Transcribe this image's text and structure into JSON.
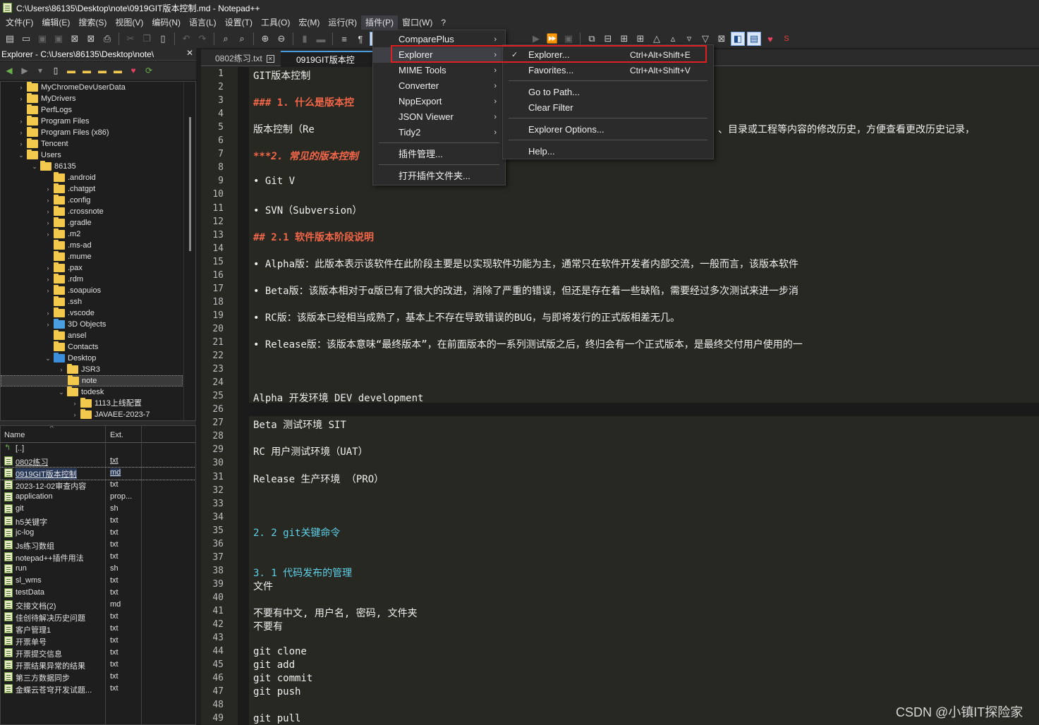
{
  "window": {
    "title": "C:\\Users\\86135\\Desktop\\note\\0919GIT版本控制.md - Notepad++"
  },
  "menubar": {
    "items": [
      "文件(F)",
      "编辑(E)",
      "搜索(S)",
      "视图(V)",
      "编码(N)",
      "语言(L)",
      "设置(T)",
      "工具(O)",
      "宏(M)",
      "运行(R)",
      "插件(P)",
      "窗口(W)",
      "?"
    ]
  },
  "explorer": {
    "title": "Explorer - C:\\Users\\86135\\Desktop\\note\\",
    "close": "✕",
    "tree": [
      {
        "label": "MyChromeDevUserData",
        "depth": 2,
        "chev": "›"
      },
      {
        "label": "MyDrivers",
        "depth": 2,
        "chev": "›"
      },
      {
        "label": "PerfLogs",
        "depth": 2,
        "chev": ""
      },
      {
        "label": "Program Files",
        "depth": 2,
        "chev": "›"
      },
      {
        "label": "Program Files (x86)",
        "depth": 2,
        "chev": "›"
      },
      {
        "label": "Tencent",
        "depth": 2,
        "chev": "›"
      },
      {
        "label": "Users",
        "depth": 2,
        "chev": "⌄"
      },
      {
        "label": "86135",
        "depth": 3,
        "chev": "⌄"
      },
      {
        "label": ".android",
        "depth": 4,
        "chev": ""
      },
      {
        "label": ".chatgpt",
        "depth": 4,
        "chev": "›"
      },
      {
        "label": ".config",
        "depth": 4,
        "chev": "›"
      },
      {
        "label": ".crossnote",
        "depth": 4,
        "chev": "›"
      },
      {
        "label": ".gradle",
        "depth": 4,
        "chev": "›"
      },
      {
        "label": ".m2",
        "depth": 4,
        "chev": "›"
      },
      {
        "label": ".ms-ad",
        "depth": 4,
        "chev": ""
      },
      {
        "label": ".mume",
        "depth": 4,
        "chev": ""
      },
      {
        "label": ".pax",
        "depth": 4,
        "chev": "›"
      },
      {
        "label": ".rdm",
        "depth": 4,
        "chev": "›"
      },
      {
        "label": ".soapuios",
        "depth": 4,
        "chev": "›"
      },
      {
        "label": ".ssh",
        "depth": 4,
        "chev": ""
      },
      {
        "label": ".vscode",
        "depth": 4,
        "chev": "›"
      },
      {
        "label": "3D Objects",
        "depth": 4,
        "chev": "›",
        "icon": "blue"
      },
      {
        "label": "ansel",
        "depth": 4,
        "chev": ""
      },
      {
        "label": "Contacts",
        "depth": 4,
        "chev": ""
      },
      {
        "label": "Desktop",
        "depth": 4,
        "chev": "⌄",
        "icon": "desk"
      },
      {
        "label": "JSR3",
        "depth": 5,
        "chev": "›"
      },
      {
        "label": "note",
        "depth": 5,
        "chev": "",
        "selected": true
      },
      {
        "label": "todesk",
        "depth": 5,
        "chev": "⌄"
      },
      {
        "label": "1113上线配置",
        "depth": 6,
        "chev": "›"
      },
      {
        "label": "JAVAEE-2023-7",
        "depth": 6,
        "chev": "›"
      }
    ],
    "columns": {
      "name": "Name",
      "ext": "Ext."
    },
    "files": [
      {
        "name": "[..]",
        "ext": "",
        "up": true
      },
      {
        "name": "0802练习",
        "ext": "txt",
        "u": true
      },
      {
        "name": "0919GIT版本控制",
        "ext": "md",
        "u": true,
        "selected": true
      },
      {
        "name": "2023-12-02审查内容",
        "ext": "txt"
      },
      {
        "name": "application",
        "ext": "prop..."
      },
      {
        "name": "git",
        "ext": "sh"
      },
      {
        "name": "h5关键字",
        "ext": "txt"
      },
      {
        "name": "jc-log",
        "ext": "txt"
      },
      {
        "name": "Js练习数组",
        "ext": "txt"
      },
      {
        "name": "notepad++插件用法",
        "ext": "txt"
      },
      {
        "name": "run",
        "ext": "sh"
      },
      {
        "name": "sl_wms",
        "ext": "txt"
      },
      {
        "name": "testData",
        "ext": "txt"
      },
      {
        "name": "交接文档(2)",
        "ext": "md"
      },
      {
        "name": "佳创待解决历史问题",
        "ext": "txt"
      },
      {
        "name": "客户管理1",
        "ext": "txt"
      },
      {
        "name": "开票单号",
        "ext": "txt"
      },
      {
        "name": "开票提交信息",
        "ext": "txt"
      },
      {
        "name": "开票结果异常的结果",
        "ext": "txt"
      },
      {
        "name": "第三方数据同步",
        "ext": "txt"
      },
      {
        "name": "金蝶云苍穹开发试题...",
        "ext": "txt"
      }
    ]
  },
  "tabs": [
    {
      "label": "0802练习.txt",
      "close": "✕"
    },
    {
      "label": "0919GIT版本控制.m",
      "active": true
    }
  ],
  "editor": {
    "lines": [
      {
        "n": "1",
        "text": "GIT版本控制",
        "cls": ""
      },
      {
        "n": "2",
        "text": "",
        "cls": ""
      },
      {
        "n": "3",
        "text": "### 1. 什么是版本控",
        "cls": "h"
      },
      {
        "n": "4",
        "text": "",
        "cls": ""
      },
      {
        "n": "5",
        "text": "       版本控制（Re",
        "cls": ""
      },
      {
        "n": "6",
        "text": "",
        "cls": ""
      },
      {
        "n": "7",
        "text": "***2. 常见的版本控制",
        "cls": "ital"
      },
      {
        "n": "8",
        "text": "",
        "cls": ""
      },
      {
        "n": "9",
        "text": "• Git   V",
        "cls": ""
      },
      {
        "n": "10",
        "text": "",
        "cls": ""
      },
      {
        "n": "11",
        "text": "• SVN（Subversion）",
        "cls": ""
      },
      {
        "n": "12",
        "text": "",
        "cls": ""
      },
      {
        "n": "13",
        "text": "##   2.1     软件版本阶段说明",
        "cls": "h"
      },
      {
        "n": "14",
        "text": "",
        "cls": ""
      },
      {
        "n": "15",
        "text": "                • Alpha版：此版本表示该软件在此阶段主要是以实现软件功能为主，通常只在软件开发者内部交流，一般而言，该版本软件",
        "cls": ""
      },
      {
        "n": "16",
        "text": "",
        "cls": ""
      },
      {
        "n": "17",
        "text": "                • Beta版：该版本相对于α版已有了很大的改进，消除了严重的错误，但还是存在着一些缺陷，需要经过多次测试来进一步消",
        "cls": ""
      },
      {
        "n": "18",
        "text": "",
        "cls": ""
      },
      {
        "n": "19",
        "text": "                • RC版：该版本已经相当成熟了，基本上不存在导致错误的BUG，与即将发行的正式版相差无几。",
        "cls": ""
      },
      {
        "n": "20",
        "text": "",
        "cls": ""
      },
      {
        "n": "21",
        "text": "                • Release版：该版本意味“最终版本”，在前面版本的一系列测试版之后，终归会有一个正式版本，是最终交付用户使用的一",
        "cls": ""
      },
      {
        "n": "22",
        "text": "",
        "cls": ""
      },
      {
        "n": "23",
        "text": "",
        "cls": ""
      },
      {
        "n": "24",
        "text": "",
        "cls": ""
      },
      {
        "n": "25",
        "text": "Alpha 开发环境 DEV  development",
        "cls": ""
      },
      {
        "n": "26",
        "text": "",
        "cls": ""
      },
      {
        "n": "27",
        "text": "Beta 测试环境 SIT",
        "cls": ""
      },
      {
        "n": "28",
        "text": "",
        "cls": ""
      },
      {
        "n": "29",
        "text": "RC 用户测试环境（UAT）",
        "cls": ""
      },
      {
        "n": "30",
        "text": "",
        "cls": ""
      },
      {
        "n": "31",
        "text": "Release 生产环境 （PRO）",
        "cls": ""
      },
      {
        "n": "32",
        "text": "",
        "cls": ""
      },
      {
        "n": "33",
        "text": "",
        "cls": ""
      },
      {
        "n": "34",
        "text": "",
        "cls": ""
      },
      {
        "n": "35",
        "text": "2. 2 git关键命令",
        "cls": "num"
      },
      {
        "n": "36",
        "text": "",
        "cls": ""
      },
      {
        "n": "37",
        "text": "",
        "cls": ""
      },
      {
        "n": "38",
        "text": "3. 1 代码发布的管理",
        "cls": "num"
      },
      {
        "n": "39",
        "text": "文件",
        "cls": ""
      },
      {
        "n": "40",
        "text": "",
        "cls": ""
      },
      {
        "n": "41",
        "text": "不要有中文, 用户名, 密码, 文件夹",
        "cls": ""
      },
      {
        "n": "42",
        "text": "不要有",
        "cls": ""
      },
      {
        "n": "43",
        "text": "",
        "cls": ""
      },
      {
        "n": "44",
        "text": "git clone",
        "cls": ""
      },
      {
        "n": "45",
        "text": "git add",
        "cls": ""
      },
      {
        "n": "46",
        "text": "git commit",
        "cls": ""
      },
      {
        "n": "47",
        "text": "git push",
        "cls": ""
      },
      {
        "n": "48",
        "text": "",
        "cls": ""
      },
      {
        "n": "49",
        "text": "git pull",
        "cls": ""
      }
    ],
    "line5_tail": "、目录或工程等内容的修改历史，方便查看更改历史记录，"
  },
  "plugins_menu": {
    "items": [
      {
        "label": "ComparePlus",
        "arrow": "›"
      },
      {
        "label": "Explorer",
        "arrow": "›",
        "highlighted": true
      },
      {
        "label": "MIME Tools",
        "arrow": "›"
      },
      {
        "label": "Converter",
        "arrow": "›"
      },
      {
        "label": "NppExport",
        "arrow": "›"
      },
      {
        "label": "JSON Viewer",
        "arrow": "›"
      },
      {
        "label": "Tidy2",
        "arrow": "›"
      },
      {
        "label": "插件管理...",
        "arrow": ""
      },
      {
        "label": "打开插件文件夹...",
        "arrow": ""
      }
    ]
  },
  "explorer_submenu": {
    "items": [
      {
        "label": "Explorer...",
        "shortcut": "Ctrl+Alt+Shift+E",
        "checked": true
      },
      {
        "label": "Favorites...",
        "shortcut": "Ctrl+Alt+Shift+V"
      },
      {
        "label": "Go to Path...",
        "shortcut": ""
      },
      {
        "label": "Clear Filter",
        "shortcut": ""
      },
      {
        "label": "Explorer Options...",
        "shortcut": ""
      },
      {
        "label": "Help...",
        "shortcut": ""
      }
    ],
    "check_mark": "✓"
  },
  "watermark": "CSDN @小镇IT探险家",
  "colors": {
    "highlight_box": "#e02020",
    "heading": "#f2664a",
    "number_heading": "#5ed0e8",
    "editor_bg": "#272822"
  }
}
